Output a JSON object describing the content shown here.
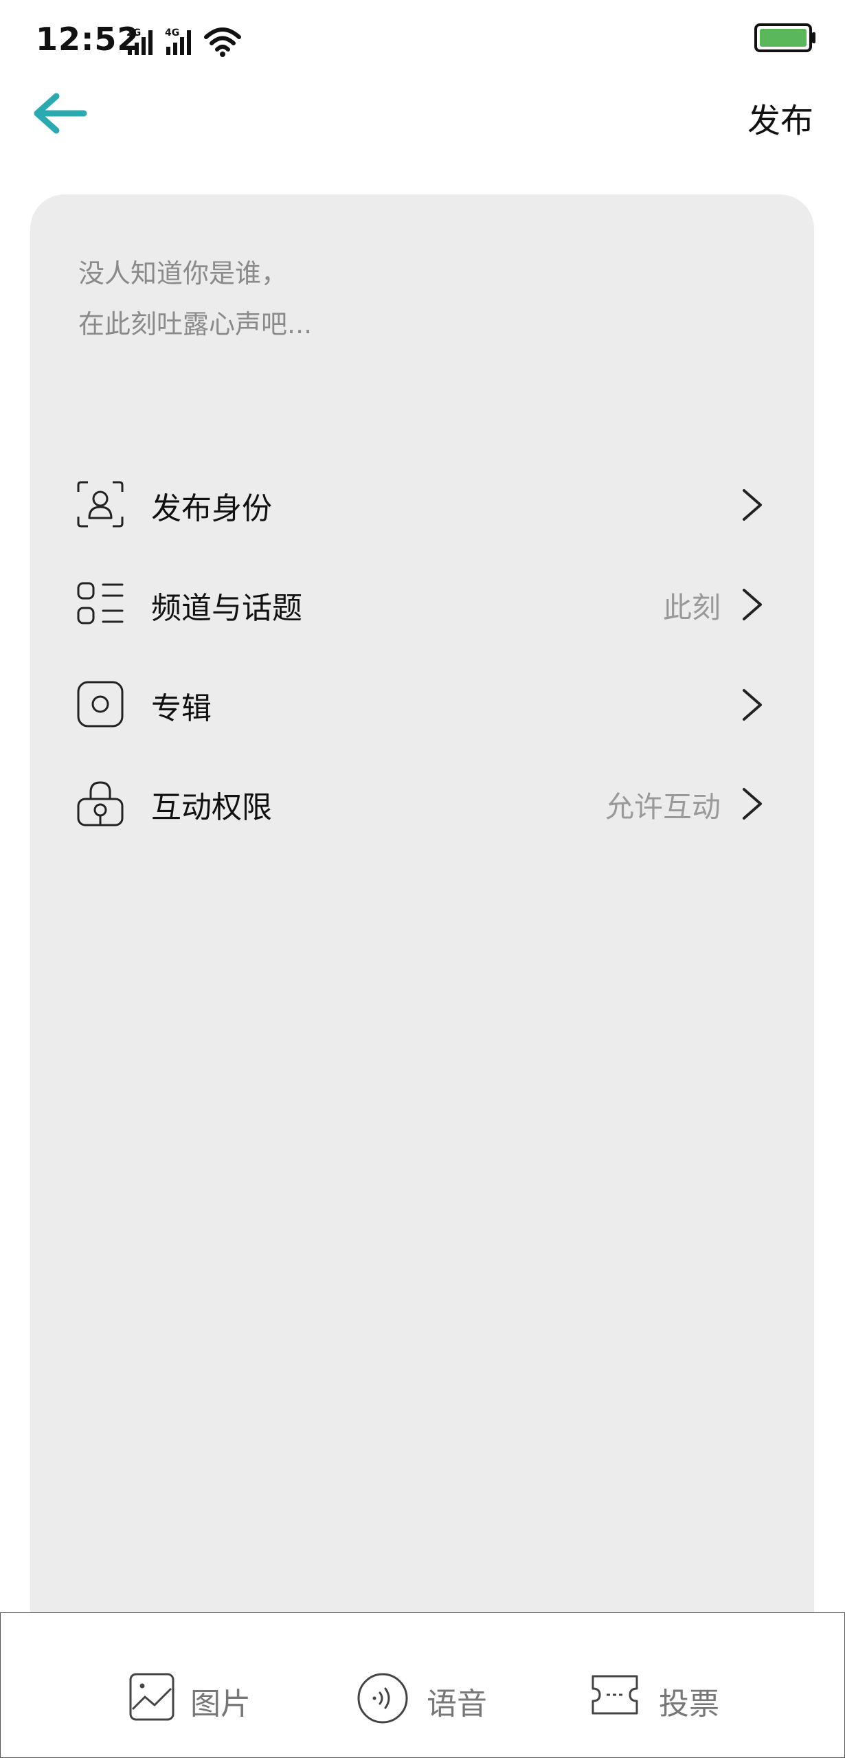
{
  "status_bar": {
    "time": "12:52",
    "network_a": "2G",
    "network_b": "4G"
  },
  "header": {
    "back_icon": "arrow-left-icon",
    "accent_color": "#2aa9b0",
    "publish_label": "发布"
  },
  "compose": {
    "placeholder_line1": "没人知道你是谁，",
    "placeholder_line2": "在此刻吐露心声吧..."
  },
  "settings": [
    {
      "icon": "person-scan-icon",
      "label": "发布身份",
      "value": ""
    },
    {
      "icon": "list-icon",
      "label": "频道与话题",
      "value": "此刻"
    },
    {
      "icon": "album-icon",
      "label": "专辑",
      "value": ""
    },
    {
      "icon": "lock-icon",
      "label": "互动权限",
      "value": "允许互动"
    }
  ],
  "toolbar": [
    {
      "icon": "image-icon",
      "label": "图片"
    },
    {
      "icon": "voice-icon",
      "label": "语音"
    },
    {
      "icon": "ticket-icon",
      "label": "投票"
    }
  ]
}
